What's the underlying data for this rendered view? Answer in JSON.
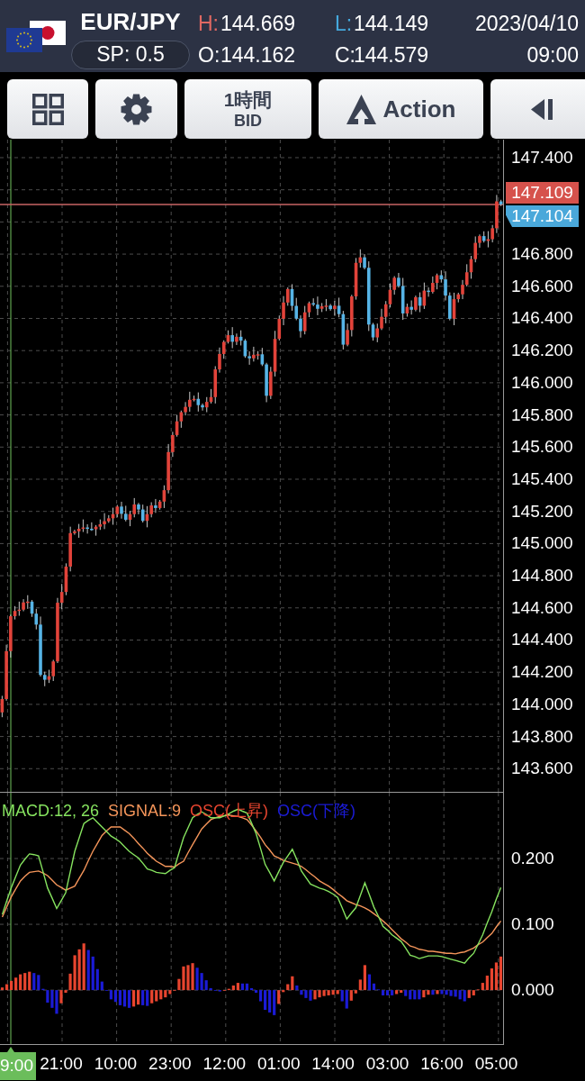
{
  "header": {
    "symbol": "EUR/JPY",
    "spread": "SP: 0.5",
    "stats": [
      {
        "label": "H:",
        "value": "144.669",
        "color": "#e06862"
      },
      {
        "label": "L:",
        "value": "144.149",
        "color": "#45a9de"
      },
      {
        "label": "O:",
        "value": "144.162",
        "color": "#ffffff"
      },
      {
        "label": "C:",
        "value": "144.579",
        "color": "#ffffff"
      }
    ],
    "date": "2023/04/10",
    "time": "09:00"
  },
  "toolbar": {
    "period_button": {
      "label": "1時間",
      "price_type": "BID"
    },
    "action_button": {
      "label": "Action"
    }
  },
  "chart": {
    "chart_data": {
      "type": "candlestick",
      "grid": true,
      "ylim": [
        143.456,
        147.512
      ],
      "yticks": [
        {
          "value": 147.4,
          "label": "147.400"
        },
        {
          "value": 146.8,
          "label": "146.800"
        },
        {
          "value": 146.6,
          "label": "146.600"
        },
        {
          "value": 146.4,
          "label": "146.400"
        },
        {
          "value": 146.2,
          "label": "146.200"
        },
        {
          "value": 146.0,
          "label": "146.000"
        },
        {
          "value": 145.8,
          "label": "145.800"
        },
        {
          "value": 145.6,
          "label": "145.600"
        },
        {
          "value": 145.4,
          "label": "145.400"
        },
        {
          "value": 145.2,
          "label": "145.200"
        },
        {
          "value": 145.0,
          "label": "145.000"
        },
        {
          "value": 144.8,
          "label": "144.800"
        },
        {
          "value": 144.6,
          "label": "144.600"
        },
        {
          "value": 144.4,
          "label": "144.400"
        },
        {
          "value": 144.2,
          "label": "144.200"
        },
        {
          "value": 144.0,
          "label": "144.000"
        },
        {
          "value": 143.8,
          "label": "143.800"
        },
        {
          "value": 143.6,
          "label": "143.600"
        }
      ],
      "ref_lines": [
        {
          "axis": "y",
          "value": 147.109,
          "color": "#c96565"
        }
      ],
      "categories": [
        null,
        null,
        null,
        null,
        null,
        null,
        null,
        null,
        null,
        null,
        null,
        null,
        null,
        null,
        null,
        null,
        null,
        null,
        null,
        null,
        null,
        null,
        null,
        null,
        null,
        null,
        null,
        null,
        null,
        null,
        null,
        null,
        null,
        null,
        null,
        null,
        null,
        null,
        null,
        null,
        null,
        null,
        null,
        null,
        null,
        null,
        null,
        null,
        null,
        null,
        null,
        null,
        null,
        null,
        null,
        null,
        null,
        null,
        null,
        null,
        null,
        null,
        null,
        null,
        null,
        null,
        null,
        null,
        null,
        null,
        null,
        null,
        null,
        null,
        null,
        null,
        null,
        null,
        null,
        null,
        null,
        null,
        null,
        null,
        null,
        null,
        null,
        null,
        null,
        null,
        null,
        null,
        null,
        null,
        null,
        null,
        null,
        null,
        null,
        null,
        null,
        null,
        null,
        null,
        null,
        null,
        null,
        null,
        null,
        null,
        null,
        null,
        null,
        null,
        null,
        null,
        null,
        null
      ],
      "ohlc": [
        [
          143.95,
          144.053,
          143.92,
          144.033
        ],
        [
          144.033,
          144.371,
          144.023,
          144.331
        ],
        [
          144.331,
          144.558,
          144.291,
          144.548
        ],
        [
          144.548,
          144.611,
          144.528,
          144.581
        ],
        [
          144.581,
          144.639,
          144.551,
          144.589
        ],
        [
          144.589,
          144.654,
          144.579,
          144.634
        ],
        [
          144.634,
          144.679,
          144.594,
          144.639
        ],
        [
          144.639,
          144.649,
          144.544,
          144.564
        ],
        [
          144.564,
          144.594,
          144.466,
          144.496
        ],
        [
          144.496,
          144.546,
          144.173,
          144.183
        ],
        [
          144.183,
          144.203,
          144.113,
          144.153
        ],
        [
          144.153,
          144.215,
          144.133,
          144.175
        ],
        [
          144.175,
          144.277,
          144.145,
          144.267
        ],
        [
          144.267,
          144.662,
          144.257,
          144.632
        ],
        [
          144.632,
          144.749,
          144.592,
          144.699
        ],
        [
          144.699,
          144.877,
          144.679,
          144.857
        ],
        [
          144.857,
          145.105,
          144.827,
          145.065
        ],
        [
          145.065,
          145.086,
          145.055,
          145.076
        ],
        [
          145.076,
          145.122,
          145.036,
          145.092
        ],
        [
          145.092,
          145.15,
          145.072,
          145.1
        ],
        [
          145.1,
          145.12,
          145.062,
          145.092
        ],
        [
          145.092,
          145.132,
          145.079,
          145.089
        ],
        [
          145.089,
          145.115,
          145.049,
          145.105
        ],
        [
          145.105,
          145.15,
          145.085,
          145.12
        ],
        [
          145.12,
          145.189,
          145.09,
          145.139
        ],
        [
          145.139,
          145.177,
          145.129,
          145.157
        ],
        [
          145.157,
          145.223,
          145.117,
          145.183
        ],
        [
          145.183,
          145.24,
          145.163,
          145.23
        ],
        [
          145.23,
          145.26,
          145.155,
          145.185
        ],
        [
          145.185,
          145.235,
          145.138,
          145.148
        ],
        [
          145.148,
          145.203,
          145.108,
          145.183
        ],
        [
          145.183,
          145.283,
          145.163,
          145.243
        ],
        [
          145.243,
          145.253,
          145.182,
          145.212
        ],
        [
          145.212,
          145.242,
          145.131,
          145.141
        ],
        [
          145.141,
          145.233,
          145.101,
          145.183
        ],
        [
          145.183,
          145.257,
          145.163,
          145.237
        ],
        [
          145.237,
          145.277,
          145.191,
          145.221
        ],
        [
          145.221,
          145.271,
          145.211,
          145.261
        ],
        [
          145.261,
          145.362,
          145.221,
          145.332
        ],
        [
          145.332,
          145.619,
          145.312,
          145.569
        ],
        [
          145.569,
          145.695,
          145.539,
          145.675
        ],
        [
          145.675,
          145.8,
          145.665,
          145.76
        ],
        [
          145.76,
          145.827,
          145.72,
          145.817
        ],
        [
          145.817,
          145.88,
          145.797,
          145.85
        ],
        [
          145.85,
          145.944,
          145.82,
          145.894
        ],
        [
          145.894,
          145.92,
          145.884,
          145.9
        ],
        [
          145.9,
          145.94,
          145.821,
          145.861
        ],
        [
          145.861,
          145.871,
          145.827,
          145.847
        ],
        [
          145.847,
          145.911,
          145.817,
          145.881
        ],
        [
          145.881,
          145.961,
          145.871,
          145.911
        ],
        [
          145.911,
          146.103,
          145.871,
          146.083
        ],
        [
          146.083,
          146.219,
          146.063,
          146.179
        ],
        [
          146.179,
          146.264,
          146.149,
          146.254
        ],
        [
          146.254,
          146.326,
          146.244,
          146.296
        ],
        [
          146.296,
          146.346,
          146.215,
          146.255
        ],
        [
          146.255,
          146.306,
          146.235,
          146.286
        ],
        [
          146.286,
          146.326,
          146.232,
          146.262
        ],
        [
          146.262,
          146.272,
          146.155,
          146.165
        ],
        [
          146.165,
          146.195,
          146.112,
          146.152
        ],
        [
          146.152,
          146.224,
          146.132,
          146.174
        ],
        [
          146.174,
          146.197,
          146.144,
          146.177
        ],
        [
          146.177,
          146.217,
          146.104,
          146.114
        ],
        [
          146.114,
          146.124,
          145.879,
          145.919
        ],
        [
          145.919,
          146.099,
          145.899,
          146.069
        ],
        [
          146.069,
          146.323,
          146.039,
          146.273
        ],
        [
          146.273,
          146.418,
          146.263,
          146.398
        ],
        [
          146.398,
          146.539,
          146.358,
          146.499
        ],
        [
          146.499,
          146.593,
          146.479,
          146.583
        ],
        [
          146.583,
          146.613,
          146.448,
          146.478
        ],
        [
          146.478,
          146.528,
          146.389,
          146.399
        ],
        [
          146.399,
          146.419,
          146.281,
          146.321
        ],
        [
          146.321,
          146.478,
          146.301,
          146.438
        ],
        [
          146.438,
          146.505,
          146.408,
          146.495
        ],
        [
          146.495,
          146.525,
          146.476,
          146.486
        ],
        [
          146.486,
          146.536,
          146.42,
          146.46
        ],
        [
          146.46,
          146.496,
          146.44,
          146.476
        ],
        [
          146.476,
          146.52,
          146.446,
          146.48
        ],
        [
          146.48,
          146.49,
          146.448,
          146.458
        ],
        [
          146.458,
          146.509,
          146.418,
          146.479
        ],
        [
          146.479,
          146.529,
          146.407,
          146.427
        ],
        [
          146.427,
          146.447,
          146.207,
          146.237
        ],
        [
          146.237,
          146.368,
          146.227,
          146.328
        ],
        [
          146.328,
          146.547,
          146.288,
          146.537
        ],
        [
          146.537,
          146.776,
          146.517,
          146.746
        ],
        [
          146.746,
          146.83,
          146.716,
          146.78
        ],
        [
          146.78,
          146.8,
          146.705,
          146.715
        ],
        [
          146.715,
          146.755,
          146.322,
          146.362
        ],
        [
          146.362,
          146.372,
          146.262,
          146.282
        ],
        [
          146.282,
          146.368,
          146.252,
          146.338
        ],
        [
          146.338,
          146.46,
          146.328,
          146.41
        ],
        [
          146.41,
          146.508,
          146.37,
          146.488
        ],
        [
          146.488,
          146.618,
          146.468,
          146.578
        ],
        [
          146.578,
          146.663,
          146.548,
          146.653
        ],
        [
          146.653,
          146.683,
          146.592,
          146.602
        ],
        [
          146.602,
          146.652,
          146.391,
          146.431
        ],
        [
          146.431,
          146.492,
          146.411,
          146.472
        ],
        [
          146.472,
          146.512,
          146.424,
          146.454
        ],
        [
          146.454,
          146.542,
          146.444,
          146.532
        ],
        [
          146.532,
          146.562,
          146.439,
          146.479
        ],
        [
          146.479,
          146.623,
          146.459,
          146.573
        ],
        [
          146.573,
          146.593,
          146.535,
          146.565
        ],
        [
          146.565,
          146.661,
          146.555,
          146.621
        ],
        [
          146.621,
          146.679,
          146.581,
          146.669
        ],
        [
          146.669,
          146.699,
          146.623,
          146.643
        ],
        [
          146.643,
          146.693,
          146.512,
          146.542
        ],
        [
          146.542,
          146.562,
          146.388,
          146.398
        ],
        [
          146.398,
          146.56,
          146.358,
          146.52
        ],
        [
          146.52,
          146.56,
          146.5,
          146.55
        ],
        [
          146.55,
          146.639,
          146.52,
          146.609
        ],
        [
          146.609,
          146.737,
          146.599,
          146.687
        ],
        [
          146.687,
          146.789,
          146.647,
          146.769
        ],
        [
          146.769,
          146.91,
          146.749,
          146.87
        ],
        [
          146.87,
          146.922,
          146.84,
          146.912
        ],
        [
          146.912,
          146.942,
          146.872,
          146.882
        ],
        [
          146.882,
          146.943,
          146.842,
          146.893
        ],
        [
          146.893,
          146.981,
          146.873,
          146.961
        ],
        [
          146.961,
          147.168,
          146.931,
          147.128
        ],
        [
          147.128,
          147.138,
          147.099,
          147.109
        ]
      ]
    },
    "price_tags": [
      {
        "value": "147.109",
        "color": "#d6524c"
      },
      {
        "value": "147.104",
        "color": "#4aa8da"
      }
    ]
  },
  "indicator": {
    "chart_data": {
      "type": "line",
      "grid": true,
      "ylim": [
        -0.082,
        0.3
      ],
      "yticks": [
        {
          "value": 0.2,
          "label": "0.200"
        },
        {
          "value": 0.1,
          "label": "0.100"
        },
        {
          "value": 0,
          "label": "0.000"
        }
      ],
      "categories": [
        null,
        null,
        null,
        null,
        null,
        null,
        null,
        null,
        null,
        null,
        null,
        null,
        null,
        "21:00",
        null,
        null,
        null,
        null,
        null,
        null,
        null,
        null,
        null,
        null,
        null,
        "10:00",
        null,
        null,
        null,
        null,
        null,
        null,
        null,
        null,
        null,
        null,
        null,
        "23:00",
        null,
        null,
        null,
        null,
        null,
        null,
        null,
        null,
        null,
        null,
        null,
        "12:00",
        null,
        null,
        null,
        null,
        null,
        null,
        null,
        null,
        null,
        null,
        null,
        "01:00",
        null,
        null,
        null,
        null,
        null,
        null,
        null,
        null,
        null,
        null,
        null,
        "14:00",
        null,
        null,
        null,
        null,
        null,
        null,
        null,
        null,
        null,
        null,
        null,
        "03:00",
        null,
        null,
        null,
        null,
        null,
        null,
        null,
        null,
        null,
        null,
        null,
        "16:00",
        null,
        null,
        null,
        null,
        null,
        null,
        null,
        null,
        null,
        null,
        null,
        "05:00",
        null
      ],
      "series": [
        {
          "name": "MACD:12, 26",
          "color": "#86e35f",
          "values": [
            0.115,
            0.136,
            0.156,
            0.173,
            0.19,
            0.199,
            0.207,
            0.206,
            0.204,
            0.18,
            0.155,
            0.14,
            0.124,
            0.136,
            0.148,
            0.18,
            0.211,
            0.232,
            0.253,
            0.258,
            0.262,
            0.255,
            0.248,
            0.241,
            0.234,
            0.23,
            0.225,
            0.218,
            0.211,
            0.206,
            0.201,
            0.193,
            0.184,
            0.182,
            0.179,
            0.178,
            0.177,
            0.182,
            0.186,
            0.209,
            0.232,
            0.247,
            0.262,
            0.267,
            0.271,
            0.267,
            0.262,
            0.262,
            0.262,
            0.265,
            0.268,
            0.272,
            0.275,
            0.272,
            0.269,
            0.254,
            0.238,
            0.215,
            0.191,
            0.179,
            0.166,
            0.18,
            0.194,
            0.204,
            0.214,
            0.198,
            0.181,
            0.171,
            0.161,
            0.158,
            0.155,
            0.153,
            0.15,
            0.146,
            0.141,
            0.125,
            0.108,
            0.117,
            0.125,
            0.144,
            0.163,
            0.145,
            0.126,
            0.112,
            0.097,
            0.091,
            0.084,
            0.079,
            0.074,
            0.064,
            0.053,
            0.051,
            0.048,
            0.05,
            0.052,
            0.052,
            0.052,
            0.051,
            0.049,
            0.047,
            0.045,
            0.043,
            0.041,
            0.049,
            0.056,
            0.07,
            0.084,
            0.102,
            0.119,
            0.138,
            0.156
          ]
        },
        {
          "name": "SIGNAL:9",
          "color": "#f4955a",
          "values": [
            0.111,
            0.127,
            0.142,
            0.154,
            0.166,
            0.173,
            0.179,
            0.18,
            0.181,
            0.178,
            0.174,
            0.167,
            0.16,
            0.156,
            0.152,
            0.155,
            0.158,
            0.17,
            0.182,
            0.197,
            0.211,
            0.223,
            0.235,
            0.242,
            0.248,
            0.248,
            0.248,
            0.243,
            0.238,
            0.231,
            0.223,
            0.216,
            0.208,
            0.202,
            0.196,
            0.192,
            0.188,
            0.188,
            0.187,
            0.192,
            0.196,
            0.209,
            0.221,
            0.233,
            0.245,
            0.252,
            0.259,
            0.262,
            0.264,
            0.265,
            0.266,
            0.265,
            0.264,
            0.262,
            0.259,
            0.251,
            0.242,
            0.232,
            0.221,
            0.213,
            0.204,
            0.201,
            0.197,
            0.195,
            0.193,
            0.191,
            0.188,
            0.183,
            0.177,
            0.172,
            0.166,
            0.162,
            0.158,
            0.153,
            0.147,
            0.142,
            0.136,
            0.133,
            0.13,
            0.128,
            0.125,
            0.121,
            0.116,
            0.111,
            0.105,
            0.099,
            0.092,
            0.085,
            0.078,
            0.073,
            0.067,
            0.065,
            0.062,
            0.061,
            0.059,
            0.059,
            0.058,
            0.057,
            0.056,
            0.056,
            0.055,
            0.057,
            0.058,
            0.061,
            0.064,
            0.069,
            0.073,
            0.08,
            0.086,
            0.096,
            0.105
          ]
        },
        {
          "name": "OSC(上昇)",
          "color": "#e8452f",
          "type": "bar",
          "values": [
            0.004,
            0.009,
            0.014,
            0.019,
            0.024,
            0.026,
            0.028,
            null,
            null,
            null,
            null,
            null,
            null,
            -0.02,
            -0.004,
            0.025,
            0.053,
            0.062,
            0.071,
            null,
            null,
            null,
            null,
            null,
            null,
            null,
            null,
            null,
            null,
            -0.025,
            -0.022,
            null,
            null,
            -0.02,
            -0.017,
            -0.014,
            -0.011,
            -0.006,
            -0.001,
            0.017,
            0.036,
            0.038,
            0.041,
            null,
            null,
            null,
            null,
            null,
            null,
            0,
            0.002,
            0.007,
            0.011,
            null,
            null,
            null,
            null,
            null,
            null,
            null,
            null,
            -0.021,
            -0.003,
            0.009,
            0.021,
            null,
            null,
            null,
            null,
            -0.014,
            -0.011,
            -0.009,
            -0.008,
            -0.007,
            -0.006,
            null,
            null,
            -0.016,
            -0.005,
            0.016,
            0.038,
            null,
            null,
            null,
            null,
            null,
            null,
            -0.006,
            -0.004,
            null,
            null,
            null,
            null,
            -0.011,
            -0.007,
            null,
            -0.006,
            null,
            null,
            null,
            null,
            null,
            null,
            -0.012,
            -0.008,
            0.001,
            0.011,
            0.022,
            0.033,
            0.042,
            0.051
          ]
        },
        {
          "name": "OSC(下降)",
          "color": "#1b1bd6",
          "type": "bar",
          "values": [
            null,
            null,
            null,
            null,
            null,
            null,
            null,
            0.026,
            0.023,
            0.002,
            -0.019,
            -0.027,
            -0.036,
            null,
            null,
            null,
            null,
            null,
            null,
            0.061,
            0.051,
            0.032,
            0.013,
            -0.001,
            -0.014,
            -0.018,
            -0.023,
            -0.025,
            -0.027,
            null,
            null,
            -0.023,
            -0.024,
            null,
            null,
            null,
            null,
            null,
            null,
            null,
            null,
            null,
            null,
            0.034,
            0.026,
            0.015,
            0.003,
            0,
            -0.002,
            null,
            null,
            null,
            null,
            0.01,
            0.01,
            0.003,
            -0.004,
            -0.017,
            -0.03,
            -0.034,
            -0.038,
            null,
            null,
            null,
            null,
            0.007,
            -0.007,
            -0.012,
            -0.016,
            null,
            null,
            null,
            null,
            null,
            null,
            -0.017,
            -0.028,
            null,
            null,
            null,
            null,
            0.024,
            0.01,
            0.001,
            -0.008,
            -0.008,
            -0.008,
            null,
            null,
            -0.009,
            -0.014,
            -0.014,
            -0.014,
            null,
            null,
            -0.007,
            null,
            -0.006,
            -0.007,
            -0.009,
            -0.01,
            -0.014,
            -0.017,
            null,
            null,
            null,
            null,
            null,
            null,
            null,
            null
          ]
        }
      ]
    },
    "cursor_label": "9:00"
  }
}
